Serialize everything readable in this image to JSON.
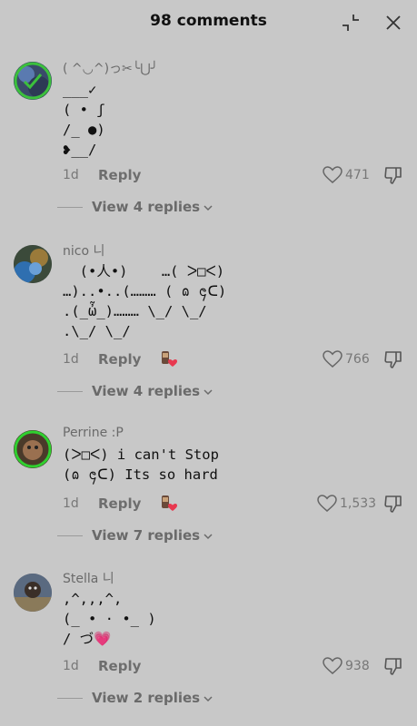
{
  "header": {
    "title": "98 comments",
    "icons": [
      "collapse-icon",
      "close-icon"
    ]
  },
  "comments": [
    {
      "username": "( ^◡^)っ✂╰⋃╯",
      "text": "___✓\n( • ʃ\n/_ ●)\n❥__/",
      "age": "1d",
      "reply_label": "Reply",
      "likes": "471",
      "view_replies": "View 4 replies",
      "avatar_ring": "#3cc03c"
    },
    {
      "username": "nico 니",
      "text": "  (•人•)    …( ᐳ□ᐸ)\n…)..•..(……… ( ɷ ᪄ᑕ)\n.(_ὦ_)……… \\_/ \\_/\n.\\_/ \\_/",
      "age": "1d",
      "reply_label": "Reply",
      "likes": "766",
      "view_replies": "View 4 replies",
      "avatar_ring": null
    },
    {
      "username": "Perrine :P",
      "text": "(ᐳ□ᐸ) i can't Stop\n(ɷ ᪄ᑕ) Its so hard",
      "age": "1d",
      "reply_label": "Reply",
      "likes": "1,533",
      "view_replies": "View 7 replies",
      "avatar_ring": "#2fcf2f"
    },
    {
      "username": "Stella 니",
      "text": ",^,,,^,\n(̲ • · •̲ )\n/ づ💗",
      "age": "1d",
      "reply_label": "Reply",
      "likes": "938",
      "view_replies": "View 2 replies",
      "avatar_ring": null
    }
  ],
  "colors": {
    "background": "#c8c8c8",
    "text": "#111111",
    "muted": "#6a6a6a",
    "heart_badge": "#e8384f"
  }
}
